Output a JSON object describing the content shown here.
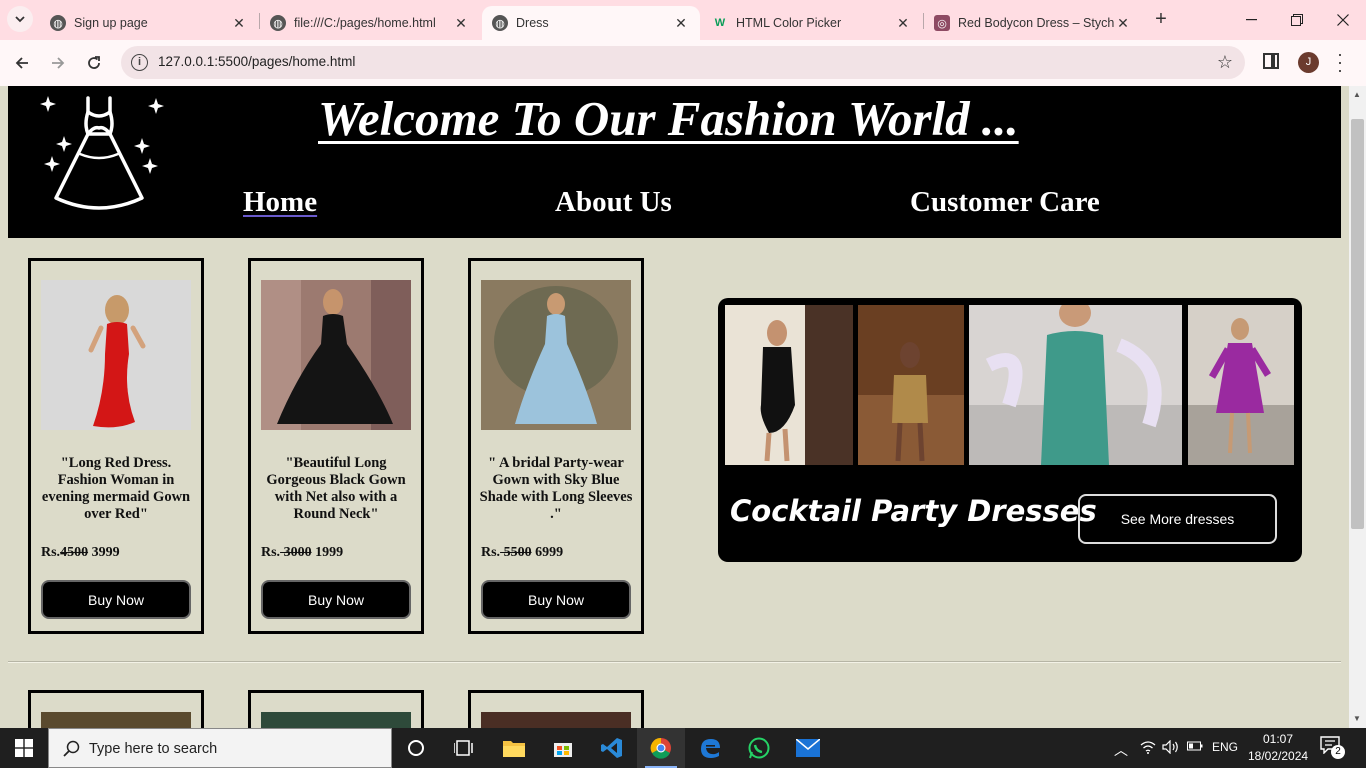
{
  "browser": {
    "tabs": [
      {
        "title": "Sign up page"
      },
      {
        "title": "file:///C:/pages/home.html"
      },
      {
        "title": "Dress"
      },
      {
        "title": "HTML Color Picker"
      },
      {
        "title": "Red Bodycon Dress – Styche"
      }
    ],
    "url": "127.0.0.1:5500/pages/home.html",
    "profile_initial": "J"
  },
  "header": {
    "title": "Welcome To Our Fashion World ...",
    "nav": [
      {
        "label": "Home"
      },
      {
        "label": "About Us"
      },
      {
        "label": "Customer Care"
      }
    ]
  },
  "products": [
    {
      "description": "\"Long Red Dress. Fashion Woman in evening mermaid Gown over Red\"",
      "currency": "Rs.",
      "old_price": "4500",
      "new_price": "3999",
      "button": "Buy Now",
      "dress_color": "#d31616",
      "bg_color": "#d9d9d9"
    },
    {
      "description": "\"Beautiful Long Gorgeous Black Gown with Net also with a Round Neck\"",
      "currency": "Rs.",
      "old_price": " 3000",
      "new_price": "1999",
      "button": "Buy Now",
      "dress_color": "#141414",
      "bg_color": "#9c7a70"
    },
    {
      "description": "\" A bridal Party-wear Gown with Sky Blue Shade with Long Sleeves .\"",
      "currency": "Rs.",
      "old_price": " 5500",
      "new_price": "6999",
      "button": "Buy Now",
      "dress_color": "#9cc3dc",
      "bg_color": "#8a7a60"
    }
  ],
  "promo": {
    "title": "Cocktail Party Dresses",
    "button": "See More dresses"
  },
  "taskbar": {
    "search_placeholder": "Type here to search",
    "language": "ENG",
    "time": "01:07",
    "date": "18/02/2024",
    "notifications": "2"
  }
}
